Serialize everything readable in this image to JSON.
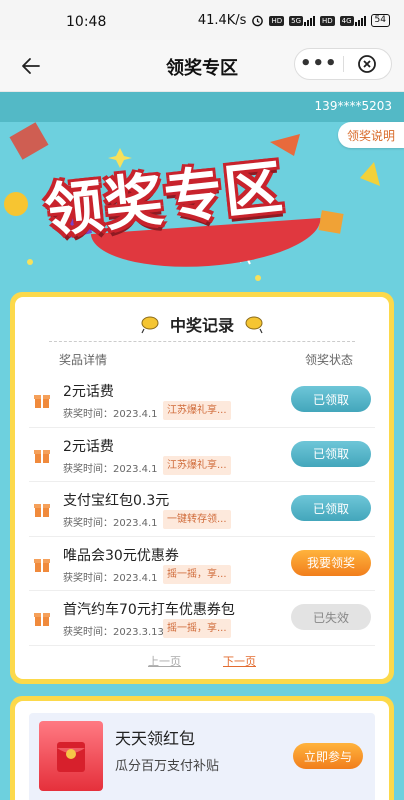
{
  "status_bar": {
    "time": "10:48",
    "network_speed": "41.4K/s",
    "badge_hd1": "HD",
    "badge_5g": "5G",
    "badge_hd2": "HD",
    "badge_4g": "4G",
    "battery": "54"
  },
  "nav": {
    "title": "领奖专区",
    "more_label": "•••"
  },
  "account": {
    "phone": "139****5203"
  },
  "banner": {
    "title": "领奖专区",
    "rules_label": "领奖说明"
  },
  "records": {
    "title": "中奖记录",
    "col_detail": "奖品详情",
    "col_status": "领奖状态",
    "items": [
      {
        "name": "2元话费",
        "time": "获奖时间：2023.4.1",
        "tag": "江苏爆礼享...",
        "status": "已领取",
        "state": "claimed"
      },
      {
        "name": "2元话费",
        "time": "获奖时间：2023.4.1",
        "tag": "江苏爆礼享...",
        "status": "已领取",
        "state": "claimed"
      },
      {
        "name": "支付宝红包0.3元",
        "time": "获奖时间：2023.4.1",
        "tag": "一键转存领...",
        "status": "已领取",
        "state": "claimed"
      },
      {
        "name": "唯品会30元优惠券",
        "time": "获奖时间：2023.4.1",
        "tag": "摇一摇，享...",
        "status": "我要领奖",
        "state": "claim"
      },
      {
        "name": "首汽约车70元打车优惠券包",
        "time": "获奖时间：2023.3.13",
        "tag": "摇一摇，享...",
        "status": "已失效",
        "state": "expired"
      }
    ],
    "prev_label": "上一页",
    "next_label": "下一页"
  },
  "promo": {
    "title": "天天领红包",
    "subtitle": "瓜分百万支付补贴",
    "button": "立即参与"
  },
  "colors": {
    "background": "#6dd0de",
    "card_border": "#fcd94b",
    "claimed": "#43a6bb",
    "claim": "#f17e1c",
    "expired": "#e3e3e3"
  }
}
